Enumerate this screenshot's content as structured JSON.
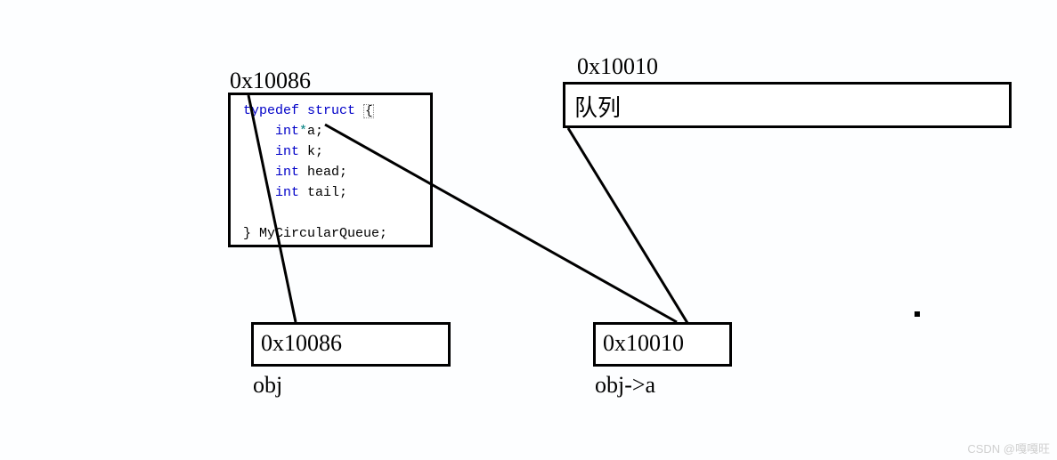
{
  "struct_box": {
    "address": "0x10086",
    "code": {
      "l1_kw1": "typedef",
      "l1_kw2": "struct",
      "l1_brace": "{",
      "l2_kw": "int",
      "l2_star": "*",
      "l2_rest": "a;",
      "l3_kw": "int",
      "l3_rest": " k;",
      "l4_kw": "int",
      "l4_rest": " head;",
      "l5_kw": "int",
      "l5_rest": " tail;",
      "blank": "",
      "l6": "} MyCircularQueue;"
    }
  },
  "queue_box": {
    "address": "0x10010",
    "label": "队列"
  },
  "obj_box": {
    "value": "0x10086",
    "caption": "obj"
  },
  "obj_a_box": {
    "value": "0x10010",
    "caption": "obj->a"
  },
  "watermark": "CSDN @嘎嘎旺"
}
